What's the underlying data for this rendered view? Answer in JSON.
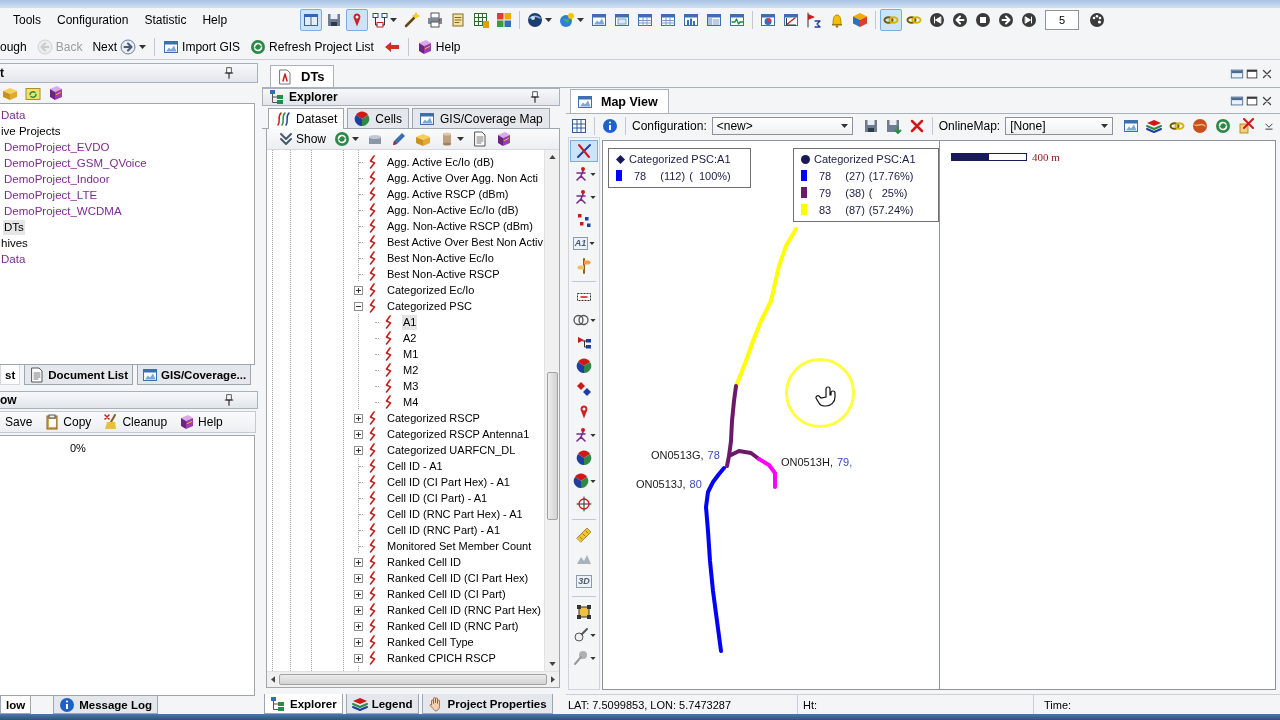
{
  "menu_bar": [
    "Tools",
    "Configuration",
    "Statistic",
    "Help"
  ],
  "main_toolbar": {
    "buttons": [
      {
        "selected": true,
        "dropdown": false
      },
      {
        "selected": false,
        "dropdown": false
      },
      {
        "selected": true,
        "dropdown": false
      },
      {
        "selected": false,
        "dropdown": true
      },
      {
        "selected": false,
        "dropdown": false
      },
      {
        "selected": false,
        "dropdown": false
      },
      {
        "selected": false,
        "dropdown": false
      },
      {
        "selected": false,
        "dropdown": false
      },
      {
        "selected": false,
        "dropdown": false
      },
      {
        "selected": false,
        "dropdown": true
      },
      {
        "selected": false,
        "dropdown": true
      },
      {
        "selected": false,
        "dropdown": false
      },
      {
        "selected": false,
        "dropdown": false
      },
      {
        "selected": false,
        "dropdown": false
      },
      {
        "selected": false,
        "dropdown": false
      },
      {
        "selected": false,
        "dropdown": false
      },
      {
        "selected": false,
        "dropdown": false
      },
      {
        "selected": false,
        "dropdown": false
      },
      {
        "selected": false,
        "dropdown": false
      },
      {
        "selected": false,
        "dropdown": false
      },
      {
        "selected": false,
        "dropdown": false
      },
      {
        "selected": false,
        "dropdown": false
      },
      {
        "selected": false,
        "dropdown": false
      },
      {
        "selected": true,
        "dropdown": false
      },
      {
        "selected": false,
        "dropdown": false
      },
      {
        "selected": false,
        "dropdown": false
      },
      {
        "selected": false,
        "dropdown": false
      },
      {
        "selected": false,
        "dropdown": false
      },
      {
        "selected": false,
        "dropdown": false
      },
      {
        "selected": false,
        "dropdown": false
      },
      {
        "selected": false,
        "dropdown": false
      }
    ],
    "step_field": "5"
  },
  "nav_toolbar": [
    {
      "label": "ough",
      "disabled": false,
      "dropdown": false
    },
    {
      "label": "Back",
      "disabled": true,
      "dropdown": false
    },
    {
      "label": "Next",
      "disabled": false,
      "dropdown": true
    },
    {
      "label": "Import GIS",
      "disabled": false,
      "dropdown": false
    },
    {
      "label": "Refresh Project List",
      "disabled": false,
      "dropdown": false
    },
    {
      "disabled": false,
      "dropdown": false
    },
    {
      "label": "Help",
      "disabled": false,
      "dropdown": false
    }
  ],
  "project_panel": {
    "title": "t",
    "tree": [
      {
        "label": "Data",
        "color": "#7b2a8e",
        "selected": false
      },
      {
        "label": "ive Projects",
        "selected": false,
        "children": [
          {
            "label": "DemoProject_EVDO",
            "color": "#7b2a8e",
            "selected": false
          },
          {
            "label": "DemoProject_GSM_QVoice",
            "color": "#7b2a8e",
            "selected": false
          },
          {
            "label": "DemoProject_Indoor",
            "color": "#7b2a8e",
            "selected": false
          },
          {
            "label": "DemoProject_LTE",
            "color": "#7b2a8e",
            "selected": false
          },
          {
            "label": "DemoProject_WCDMA",
            "color": "#7b2a8e",
            "selected": false
          },
          {
            "label": "DTs",
            "selected": true
          }
        ]
      },
      {
        "label": "hives",
        "selected": false
      },
      {
        "label": "Data",
        "color": "#7b2a8e",
        "selected": false
      }
    ],
    "tabs": [
      {
        "label": "st",
        "selected": true
      },
      {
        "label": "Document List",
        "selected": false
      },
      {
        "label": "GIS/Coverage...",
        "selected": false
      }
    ]
  },
  "workflow_panel": {
    "title": "ow",
    "toolbar": [
      "Save",
      "Copy",
      "Cleanup",
      "Help"
    ],
    "progress": "0%",
    "tabs": [
      {
        "label": "low",
        "selected": true
      },
      {
        "label": "Message Log",
        "selected": false
      }
    ]
  },
  "document_tabs": [
    {
      "label": "DTs",
      "selected": true
    }
  ],
  "explorer": {
    "title": "Explorer",
    "tabs": [
      {
        "label": "Dataset",
        "selected": true
      },
      {
        "label": "Cells",
        "selected": false
      },
      {
        "label": "GIS/Coverage Map",
        "selected": false
      }
    ],
    "toolbar": [
      {
        "label": "Show",
        "dropdown": false
      },
      {
        "dropdown": true
      },
      {
        "dropdown": false
      },
      {
        "dropdown": false
      },
      {
        "dropdown": false
      },
      {
        "dropdown": true
      },
      {
        "dropdown": false
      },
      {
        "dropdown": false
      }
    ],
    "tree": [
      {
        "label": "Agg. Active Ec/Io (dB)",
        "selected": false
      },
      {
        "label": "Agg. Active Over Agg. Non Acti",
        "selected": false
      },
      {
        "label": "Agg. Active RSCP (dBm)",
        "selected": false
      },
      {
        "label": "Agg. Non-Active Ec/Io (dB)",
        "selected": false
      },
      {
        "label": "Agg. Non-Active RSCP (dBm)",
        "selected": false
      },
      {
        "label": "Best Active Over Best Non Activ",
        "selected": false
      },
      {
        "label": "Best Non-Active Ec/Io",
        "selected": false
      },
      {
        "label": "Best Non-Active RSCP",
        "selected": false
      },
      {
        "label": "Categorized Ec/Io",
        "expanded": false,
        "selected": false
      },
      {
        "label": "Categorized PSC",
        "expanded": true,
        "selected": false,
        "children": [
          {
            "label": "A1",
            "selected": true
          },
          {
            "label": "A2",
            "selected": false
          },
          {
            "label": "M1",
            "selected": false
          },
          {
            "label": "M2",
            "selected": false
          },
          {
            "label": "M3",
            "selected": false
          },
          {
            "label": "M4",
            "selected": false
          }
        ]
      },
      {
        "label": "Categorized RSCP",
        "expanded": false,
        "selected": false
      },
      {
        "label": "Categorized RSCP Antenna1",
        "expanded": false,
        "selected": false
      },
      {
        "label": "Categorized UARFCN_DL",
        "expanded": false,
        "selected": false
      },
      {
        "label": "Cell ID - A1",
        "selected": false
      },
      {
        "label": "Cell ID (CI Part Hex) - A1",
        "selected": false
      },
      {
        "label": "Cell ID (CI Part) - A1",
        "selected": false
      },
      {
        "label": "Cell ID (RNC Part Hex) - A1",
        "selected": false
      },
      {
        "label": "Cell ID (RNC Part) - A1",
        "selected": false
      },
      {
        "label": "Monitored Set Member Count",
        "selected": false
      },
      {
        "label": "Ranked Cell ID",
        "expanded": false,
        "selected": false
      },
      {
        "label": "Ranked Cell ID (CI Part Hex)",
        "expanded": false,
        "selected": false
      },
      {
        "label": "Ranked Cell ID (CI Part)",
        "expanded": false,
        "selected": false
      },
      {
        "label": "Ranked Cell ID (RNC Part Hex)",
        "expanded": false,
        "selected": false
      },
      {
        "label": "Ranked Cell ID (RNC Part)",
        "expanded": false,
        "selected": false
      },
      {
        "label": "Ranked Cell Type",
        "expanded": false,
        "selected": false
      },
      {
        "label": "Ranked CPICH RSCP",
        "expanded": false,
        "selected": false
      }
    ],
    "bottom_tabs": [
      {
        "label": "Explorer",
        "selected": true
      },
      {
        "label": "Legend",
        "selected": false
      },
      {
        "label": "Project Properties",
        "selected": false
      }
    ]
  },
  "map_view": {
    "title": "Map View",
    "configuration_label": "Configuration:",
    "configuration": "<new>",
    "online_map_label": "OnlineMap:",
    "online_map": "[None]",
    "side_tools": [
      {
        "selected": true,
        "dropdown": false
      },
      {
        "selected": false,
        "dropdown": true
      },
      {
        "selected": false,
        "dropdown": true
      },
      {
        "selected": false,
        "dropdown": false
      },
      {
        "text": "A1",
        "selected": false,
        "dropdown": true
      },
      {
        "selected": false,
        "dropdown": false
      },
      {
        "selected": false,
        "dropdown": false
      },
      {
        "selected": false,
        "dropdown": true
      },
      {
        "selected": false,
        "dropdown": false
      },
      {
        "selected": false,
        "dropdown": false
      },
      {
        "selected": false,
        "dropdown": false
      },
      {
        "selected": false,
        "dropdown": false
      },
      {
        "selected": false,
        "dropdown": true
      },
      {
        "selected": false,
        "dropdown": false
      },
      {
        "selected": false,
        "dropdown": true
      },
      {
        "selected": false,
        "dropdown": false
      },
      {
        "selected": false,
        "dropdown": false
      },
      {
        "selected": false,
        "dropdown": false
      },
      {
        "text": "3D",
        "selected": false,
        "dropdown": false
      },
      {
        "selected": false,
        "dropdown": false
      },
      {
        "selected": false,
        "dropdown": true
      },
      {
        "selected": false,
        "dropdown": true
      }
    ],
    "legends": [
      {
        "title": "Categorized PSC:A1",
        "entries": [
          {
            "value": "78",
            "count": "(112)",
            "share": "(  100%)",
            "color": "#0000ff"
          }
        ]
      },
      {
        "title": "Categorized PSC:A1",
        "entries": [
          {
            "value": "78",
            "count": "(27)",
            "share": "(17.76%)",
            "color": "#0000ff"
          },
          {
            "value": "79",
            "count": "(38)",
            "share": "(   25%)",
            "color": "#6b1a6b"
          },
          {
            "value": "83",
            "count": "(87)",
            "share": "(57.24%)",
            "color": "#ffff00"
          }
        ]
      }
    ],
    "sites": [
      {
        "name": "ON0513G,",
        "psc": "78"
      },
      {
        "name": "ON0513H,",
        "psc": "79,"
      },
      {
        "name": "ON0513J,",
        "psc": "80"
      }
    ],
    "scale_label": "400 m"
  },
  "status_bar": {
    "position": "LAT: 7.5099853, LON: 5.7473287",
    "height_label": "Ht:",
    "time_label": "Time:"
  }
}
